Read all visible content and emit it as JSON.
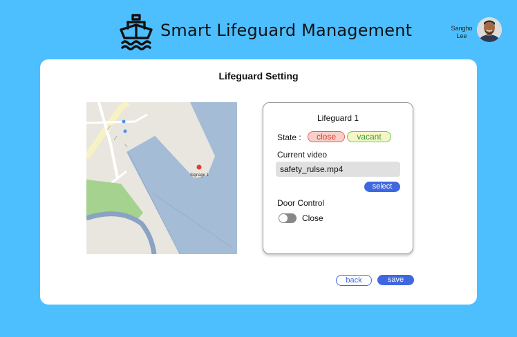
{
  "header": {
    "title": "Smart Lifeguard Management",
    "logo_icon": "ship-icon",
    "user": {
      "first_name": "Sangho",
      "last_name": "Lee",
      "avatar_icon": "user-avatar"
    }
  },
  "card": {
    "title": "Lifeguard Setting"
  },
  "map": {
    "marker_label": "Signage 1",
    "marker_color": "#e53935"
  },
  "panel": {
    "title": "Lifeguard 1",
    "state_label": "State :",
    "state_close": "close",
    "state_vacant": "vacant",
    "video_label": "Current video",
    "video_value": "safety_rulse.mp4",
    "select_label": "select",
    "door_label": "Door Control",
    "door_state": "Close",
    "door_on": false
  },
  "actions": {
    "back_label": "back",
    "save_label": "save"
  },
  "colors": {
    "background": "#4dbfff",
    "accent": "#3f67e0",
    "water": "#a4bcd8",
    "park": "#9fcf8e"
  }
}
